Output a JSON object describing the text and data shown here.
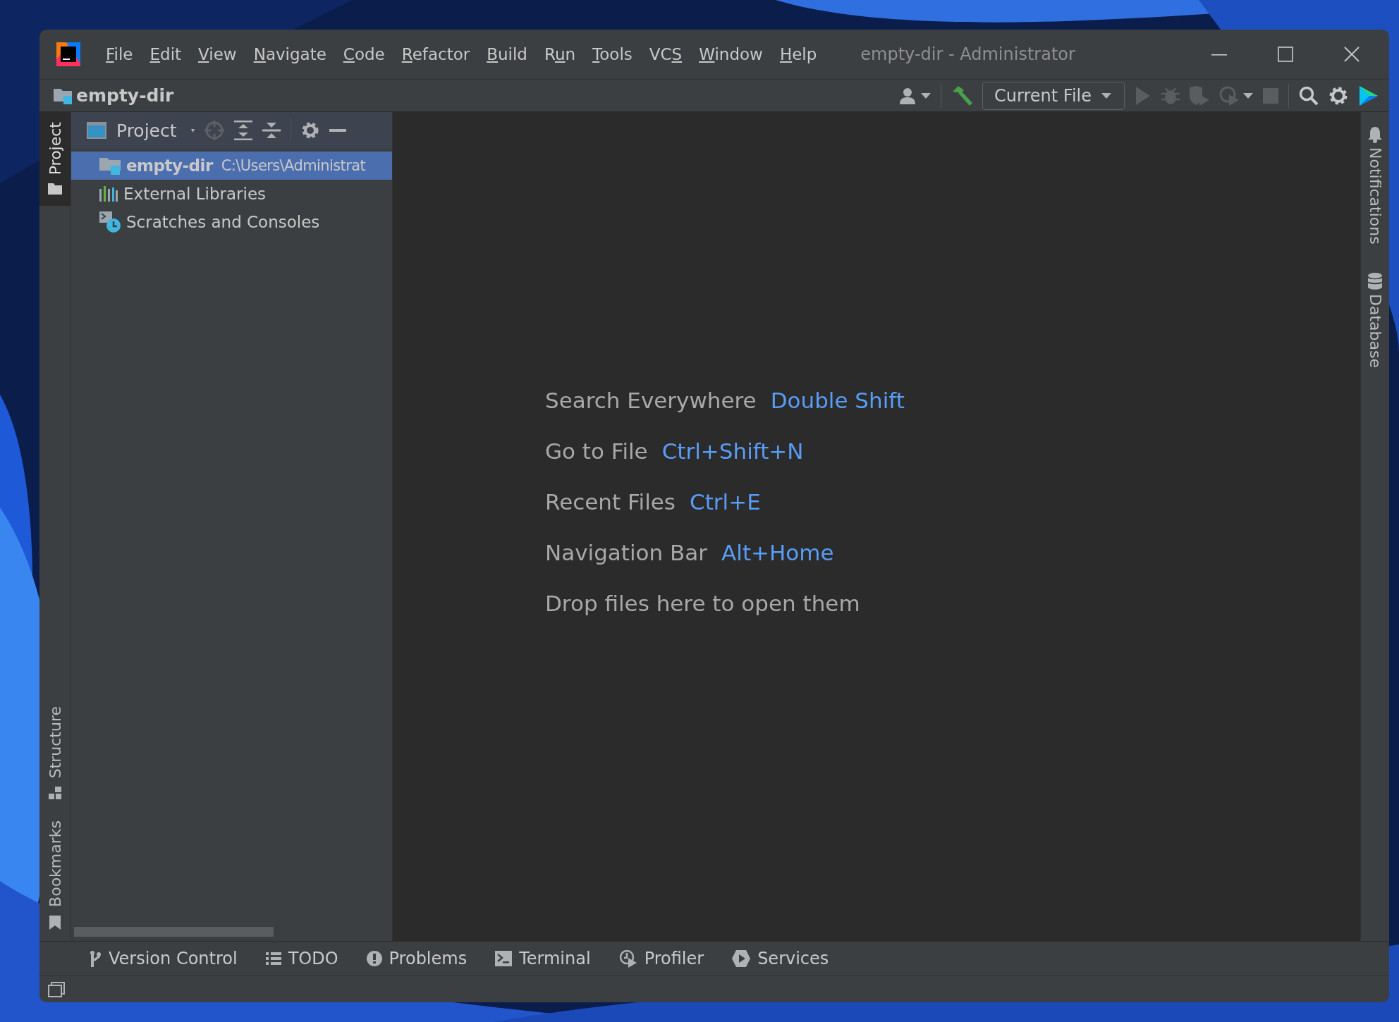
{
  "window": {
    "title": "empty-dir - Administrator",
    "menu": [
      {
        "key": "F",
        "after": "ile"
      },
      {
        "key": "E",
        "after": "dit"
      },
      {
        "key": "V",
        "after": "iew"
      },
      {
        "key": "N",
        "after": "avigate"
      },
      {
        "key": "C",
        "after": "ode"
      },
      {
        "key": "R",
        "after": "efactor"
      },
      {
        "key": "B",
        "after": "uild"
      },
      {
        "before": "R",
        "key": "u",
        "after": "n"
      },
      {
        "key": "T",
        "after": "ools"
      },
      {
        "before": "VC",
        "key": "S"
      },
      {
        "key": "W",
        "after": "indow"
      },
      {
        "key": "H",
        "after": "elp"
      }
    ]
  },
  "navbar": {
    "project": "empty-dir",
    "run_config": "Current File"
  },
  "left_strip": {
    "top": [
      {
        "label": "Project",
        "kind": "project",
        "selected": true
      }
    ],
    "bottom": [
      {
        "label": "Structure",
        "kind": "structure",
        "selected": false
      },
      {
        "label": "Bookmarks",
        "kind": "bookmarks",
        "selected": false
      }
    ]
  },
  "project_panel": {
    "title": "Project",
    "tree": [
      {
        "label": "empty-dir",
        "path": "C:\\Users\\Administrat",
        "kind": "module",
        "selected": true
      },
      {
        "label": "External Libraries",
        "kind": "libraries",
        "selected": false
      },
      {
        "label": "Scratches and Consoles",
        "kind": "scratches",
        "selected": false
      }
    ]
  },
  "editor_hints": [
    {
      "action": "Search Everywhere",
      "shortcut": "Double Shift"
    },
    {
      "action": "Go to File",
      "shortcut": "Ctrl+Shift+N"
    },
    {
      "action": "Recent Files",
      "shortcut": "Ctrl+E"
    },
    {
      "action": "Navigation Bar",
      "shortcut": "Alt+Home"
    },
    {
      "action": "Drop files here to open them"
    }
  ],
  "right_strip": [
    {
      "label": "Notifications",
      "kind": "notifications"
    },
    {
      "label": "Database",
      "kind": "database"
    }
  ],
  "tool_windows": [
    {
      "label": "Version Control",
      "kind": "vcs"
    },
    {
      "label": "TODO",
      "kind": "todo"
    },
    {
      "label": "Problems",
      "kind": "problems"
    },
    {
      "label": "Terminal",
      "kind": "terminal"
    },
    {
      "label": "Profiler",
      "kind": "profiler"
    },
    {
      "label": "Services",
      "kind": "services"
    }
  ]
}
